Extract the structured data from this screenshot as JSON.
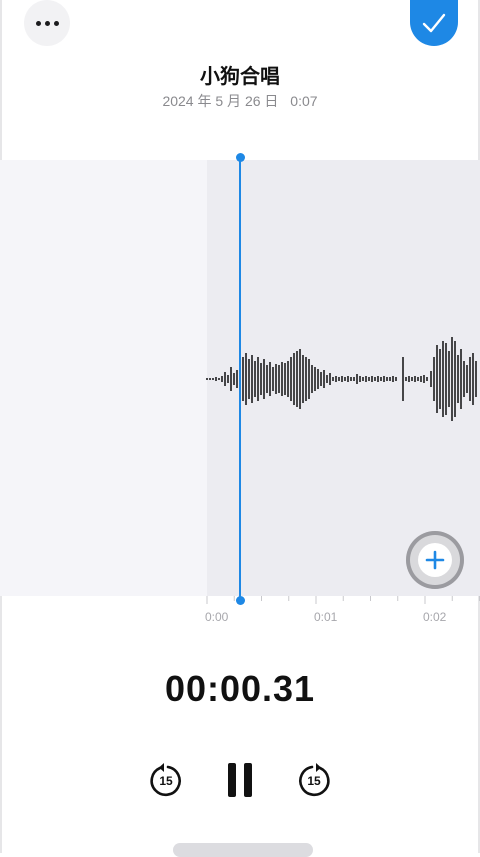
{
  "header": {
    "title": "小狗合唱",
    "date": "2024 年 5 月 26 日",
    "duration": "0:07"
  },
  "timeline": {
    "labels": [
      "0:00",
      "0:01",
      "0:02"
    ],
    "playhead_time": "00:00.31"
  },
  "controls": {
    "skip_back": "15",
    "skip_forward": "15"
  },
  "colors": {
    "accent": "#1e88e5",
    "waveform": "#1c1c1e",
    "played_bg": "#f5f5f9",
    "unplayed_bg": "#ececf1"
  },
  "icons": {
    "more": "ellipsis-icon",
    "done": "checkmark-icon",
    "add": "plus-icon",
    "skip_back": "gobackward-15-icon",
    "pause": "pause-icon",
    "skip_forward": "goforward-15-icon"
  }
}
